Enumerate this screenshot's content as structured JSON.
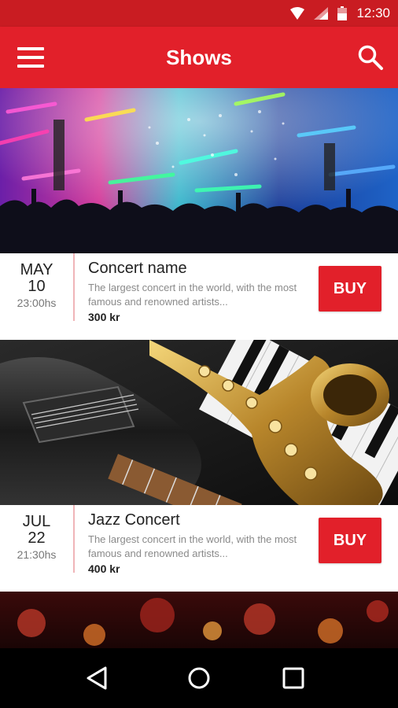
{
  "status_bar": {
    "time": "12:30",
    "icons": [
      "wifi-icon",
      "cell-signal-icon",
      "battery-icon"
    ]
  },
  "app_bar": {
    "title": "Shows",
    "menu_icon": "menu-icon",
    "search_icon": "search-icon"
  },
  "shows": [
    {
      "month": "MAY",
      "day": "10",
      "time": "23:00hs",
      "name": "Concert name",
      "description": "The largest concert in the world, with the most famous and renowned artists...",
      "price": "300 kr",
      "buy_label": "BUY",
      "image": "concert-crowd-image"
    },
    {
      "month": "JUL",
      "day": "22",
      "time": "21:30hs",
      "name": "Jazz Concert",
      "description": "The largest concert in the world, with the most famous and renowned artists...",
      "price": "400 kr",
      "buy_label": "BUY",
      "image": "guitar-saxophone-image"
    }
  ],
  "partial_card": {
    "image": "bokeh-lights-image"
  },
  "nav_bar": {
    "icons": [
      "back-icon",
      "home-icon",
      "recents-icon"
    ]
  },
  "colors": {
    "primary": "#e2202a",
    "status_bar": "#c91c22",
    "divider": "#f0b5b8"
  }
}
